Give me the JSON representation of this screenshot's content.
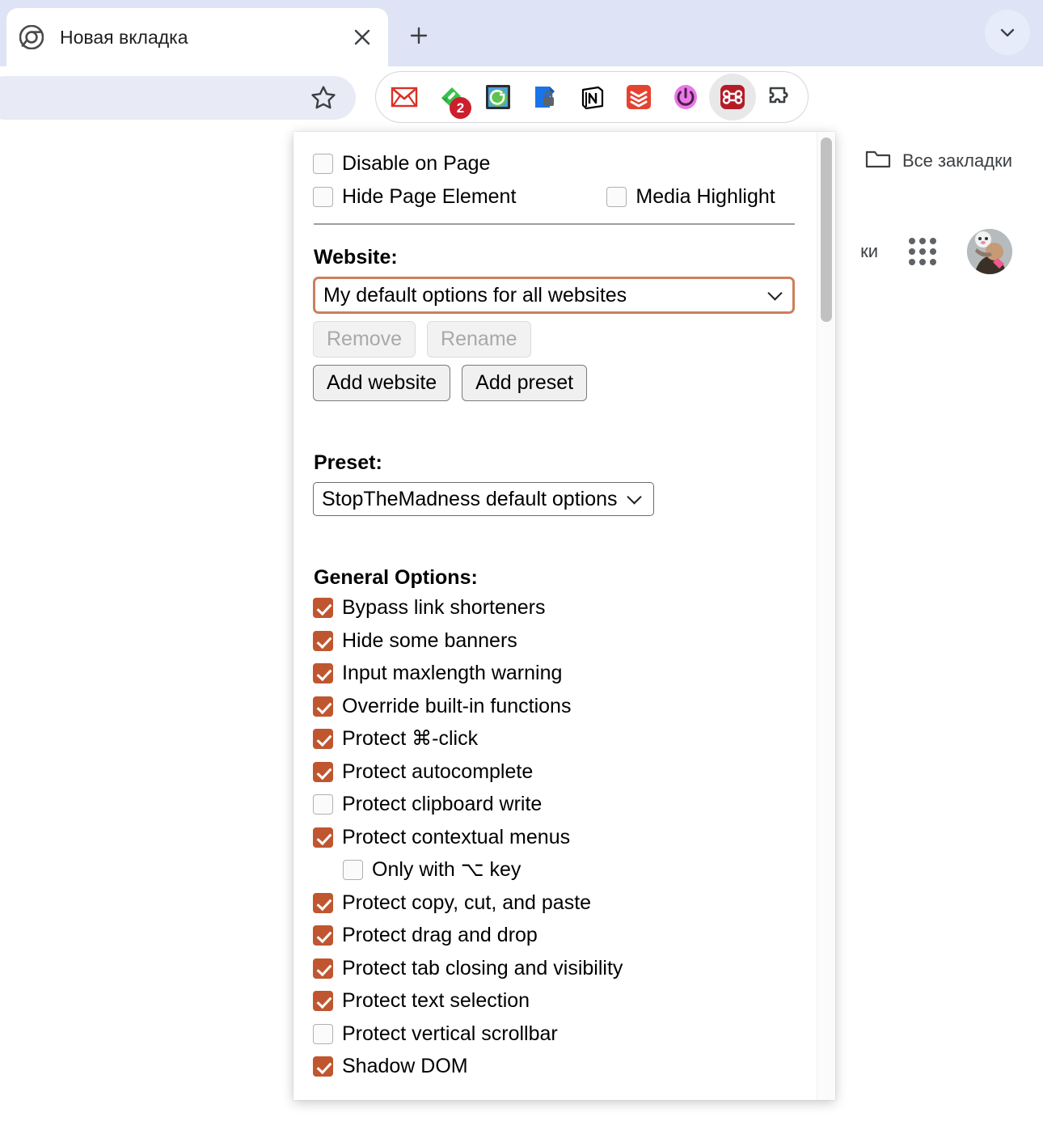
{
  "browser": {
    "tab": {
      "title": "Новая вкладка",
      "favicon_icon": "chrome-logo-icon",
      "close_icon": "close-icon"
    },
    "new_tab_button_icon": "plus-icon",
    "tabstrip_menu_icon": "chevron-down-icon",
    "omnibox": {
      "value": "",
      "placeholder": "",
      "bookmark_icon": "star-icon"
    },
    "extensions": [
      {
        "name": "gmail-extension",
        "icon": "gmail-icon",
        "badge": ""
      },
      {
        "name": "evernote-extension",
        "icon": "evernote-icon",
        "badge": "2"
      },
      {
        "name": "whatsapp-extension",
        "icon": "whatsapp-icon",
        "badge": ""
      },
      {
        "name": "password-manager-extension",
        "icon": "shield-lock-icon",
        "badge": ""
      },
      {
        "name": "notion-extension",
        "icon": "notion-icon",
        "badge": ""
      },
      {
        "name": "todoist-extension",
        "icon": "todoist-icon",
        "badge": ""
      },
      {
        "name": "power-extension",
        "icon": "power-icon",
        "badge": ""
      },
      {
        "name": "stopthemadness-extension",
        "icon": "command-key-icon",
        "badge": ""
      },
      {
        "name": "extensions-menu",
        "icon": "puzzle-piece-icon",
        "badge": ""
      }
    ],
    "profile_icon": "avatar",
    "browser_menu_icon": "three-dots-vertical-icon",
    "bookmarks": {
      "all_bookmarks_label": "Все закладки",
      "all_bookmarks_icon": "folder-icon"
    },
    "new_tab_page": {
      "link_text": "ки",
      "apps_icon": "apps-grid-icon",
      "account_icon": "account-avatar"
    }
  },
  "popup": {
    "top_toggles": [
      {
        "label": "Disable on Page",
        "checked": false
      },
      {
        "label": "Hide Page Element",
        "checked": false
      },
      {
        "label": "Media Highlight",
        "checked": false
      }
    ],
    "website": {
      "title": "Website:",
      "selected": "My default options for all websites",
      "options": [
        "My default options for all websites"
      ],
      "remove_label": "Remove",
      "remove_disabled": true,
      "rename_label": "Rename",
      "rename_disabled": true,
      "add_website_label": "Add website",
      "add_preset_label": "Add preset"
    },
    "preset": {
      "title": "Preset:",
      "selected": "StopTheMadness default options",
      "options": [
        "StopTheMadness default options"
      ]
    },
    "general_options": {
      "title": "General Options:",
      "items": [
        {
          "label": "Bypass link shorteners",
          "checked": true,
          "indent": false
        },
        {
          "label": "Hide some banners",
          "checked": true,
          "indent": false
        },
        {
          "label": "Input maxlength warning",
          "checked": true,
          "indent": false
        },
        {
          "label": "Override built-in functions",
          "checked": true,
          "indent": false
        },
        {
          "label": "Protect ⌘-click",
          "checked": true,
          "indent": false
        },
        {
          "label": "Protect autocomplete",
          "checked": true,
          "indent": false
        },
        {
          "label": "Protect clipboard write",
          "checked": false,
          "indent": false
        },
        {
          "label": "Protect contextual menus",
          "checked": true,
          "indent": false
        },
        {
          "label": "Only with ⌥ key",
          "checked": false,
          "indent": true
        },
        {
          "label": "Protect copy, cut, and paste",
          "checked": true,
          "indent": false
        },
        {
          "label": "Protect drag and drop",
          "checked": true,
          "indent": false
        },
        {
          "label": "Protect tab closing and visibility",
          "checked": true,
          "indent": false
        },
        {
          "label": "Protect text selection",
          "checked": true,
          "indent": false
        },
        {
          "label": "Protect vertical scrollbar",
          "checked": false,
          "indent": false
        },
        {
          "label": "Shadow DOM",
          "checked": true,
          "indent": false
        }
      ]
    },
    "colors": {
      "accent": "#c0562f",
      "focus_ring": "#cd7f5c"
    }
  }
}
